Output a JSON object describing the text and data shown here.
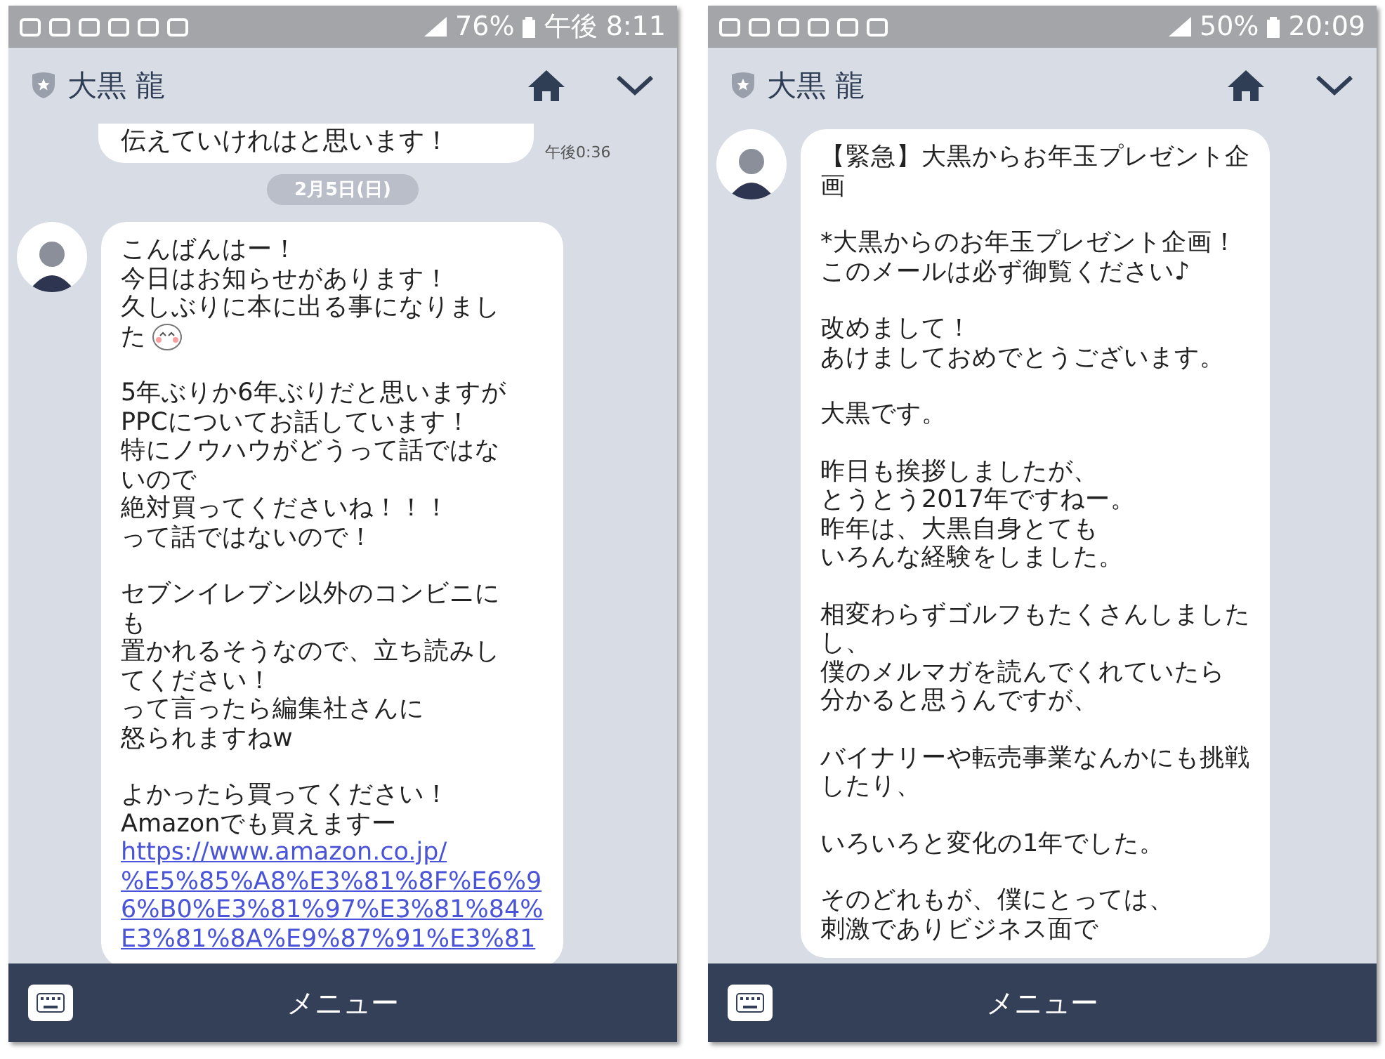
{
  "phones": [
    {
      "status": {
        "battery": "76%",
        "time": "午後 8:11"
      },
      "header": {
        "title": "大黒 龍"
      },
      "messages": [
        {
          "kind": "partial",
          "text": "伝えていけれはと思います！",
          "time": "午後0:36"
        },
        {
          "kind": "date",
          "text": "2月5日(日)"
        },
        {
          "kind": "bubble",
          "paragraphs": [
            {
              "lines": [
                "こんばんはー！",
                "今日はお知らせがあります！",
                "久しぶりに本に出る事になりまし",
                "た"
              ],
              "emoji": true
            },
            {
              "lines": [
                "5年ぶりか6年ぶりだと思いますが",
                "PPCについてお話しています！",
                "特にノウハウがどうって話ではな",
                "いので",
                "絶対買ってくださいね！！！",
                "って話ではないので！"
              ]
            },
            {
              "lines": [
                "セブンイレブン以外のコンビニに",
                "も",
                "置かれるそうなので、立ち読みし",
                "てください！",
                "って言ったら編集社さんに",
                "怒られますねw"
              ]
            },
            {
              "lines": [
                "よかったら買ってください！",
                "Amazonでも買えますー"
              ],
              "links": [
                "https://www.amazon.co.jp/",
                "%E5%85%A8%E3%81%8F%E6%9",
                "6%B0%E3%81%97%E3%81%84%",
                "E3%81%8A%E9%87%91%E3%81"
              ]
            }
          ]
        }
      ],
      "menu": {
        "label": "メニュー"
      }
    },
    {
      "status": {
        "battery": "50%",
        "time": "20:09"
      },
      "header": {
        "title": "大黒 龍"
      },
      "messages": [
        {
          "kind": "bubble",
          "paragraphs": [
            {
              "lines": [
                "【緊急】大黒からお年玉プレゼント企",
                "画"
              ]
            },
            {
              "lines": [
                "*大黒からのお年玉プレゼント企画！",
                "このメールは必ず御覧ください♪"
              ]
            },
            {
              "lines": [
                "改めまして！",
                "あけましておめでとうございます。"
              ]
            },
            {
              "lines": [
                "大黒です。"
              ]
            },
            {
              "lines": [
                "昨日も挨拶しましたが、",
                "とうとう2017年ですねー。",
                "昨年は、大黒自身とても",
                "いろんな経験をしました。"
              ]
            },
            {
              "lines": [
                "相変わらずゴルフもたくさんしました",
                "し、",
                "僕のメルマガを読んでくれていたら",
                "分かると思うんですが、"
              ]
            },
            {
              "lines": [
                "バイナリーや転売事業なんかにも挑戦",
                "したり、"
              ]
            },
            {
              "lines": [
                "いろいろと変化の1年でした。"
              ]
            },
            {
              "lines": [
                "そのどれもが、僕にとっては、",
                "刺激でありビジネス面で"
              ]
            }
          ]
        }
      ],
      "menu": {
        "label": "メニュー"
      }
    }
  ]
}
